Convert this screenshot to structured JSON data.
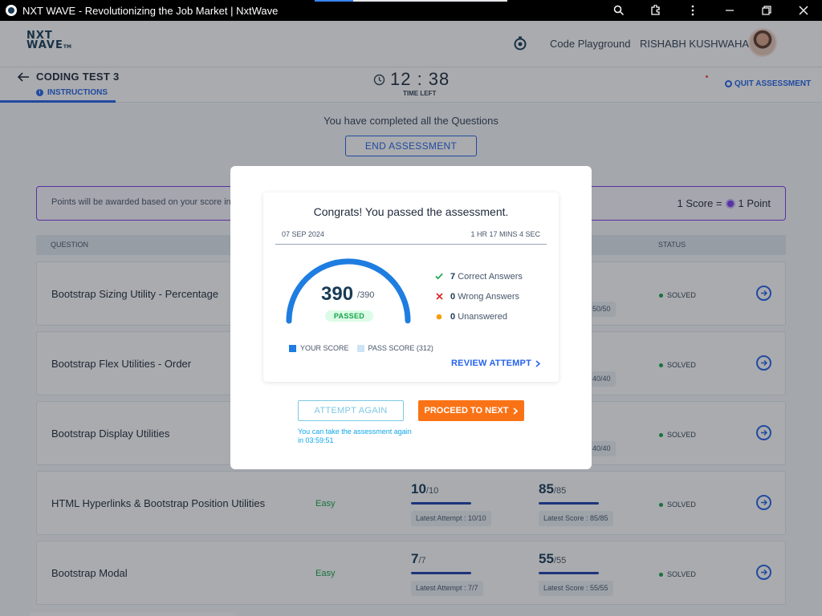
{
  "browser": {
    "title": "NXT WAVE - Revolutionizing the Job Market | NxtWave",
    "progress_fraction": 0.2
  },
  "header": {
    "logo_line1": "NXT",
    "logo_line2": "WAVE",
    "logo_tm": "TM",
    "playground": "Code Playground",
    "username": "RISHABH KUSHWAHA"
  },
  "subheader": {
    "test_title": "CODING TEST 3",
    "instructions": "INSTRUCTIONS",
    "timer": "12 : 38",
    "time_left_label": "TIME LEFT",
    "quit": "QUIT ASSESSMENT"
  },
  "main": {
    "completed_text": "You have completed all the Questions",
    "end_button": "END ASSESSMENT",
    "points_note": "Points will be awarded based on your score in",
    "score_eq": "1 Score =",
    "point_label": "1 Point",
    "columns": {
      "question": "QUESTION",
      "status": "STATUS"
    },
    "rows": [
      {
        "name": "Bootstrap Sizing Utility - Percentage",
        "difficulty": "",
        "attempt_big": "",
        "attempt_max": "",
        "attempt_chip": "",
        "score_big": "",
        "score_max": "",
        "score_chip": "50/50",
        "status": "SOLVED"
      },
      {
        "name": "Bootstrap Flex Utilities - Order",
        "difficulty": "",
        "attempt_big": "",
        "attempt_max": "",
        "attempt_chip": "",
        "score_big": "",
        "score_max": "",
        "score_chip": "40/40",
        "status": "SOLVED"
      },
      {
        "name": "Bootstrap Display Utilities",
        "difficulty": "",
        "attempt_big": "",
        "attempt_max": "",
        "attempt_chip": "",
        "score_big": "",
        "score_max": "",
        "score_chip": "40/40",
        "status": "SOLVED"
      },
      {
        "name": "HTML Hyperlinks & Bootstrap Position Utilities",
        "difficulty": "Easy",
        "attempt_big": "10",
        "attempt_max": "/10",
        "attempt_chip": "Latest Attempt : 10/10",
        "score_big": "85",
        "score_max": "/85",
        "score_chip": "Latest Score : 85/85",
        "status": "SOLVED"
      },
      {
        "name": "Bootstrap Modal",
        "difficulty": "Easy",
        "attempt_big": "7",
        "attempt_max": "/7",
        "attempt_chip": "Latest Attempt : 7/7",
        "score_big": "55",
        "score_max": "/55",
        "score_chip": "Latest Score : 55/55",
        "status": "SOLVED"
      }
    ]
  },
  "modal": {
    "congrats": "Congrats! You passed the assessment.",
    "date": "07 SEP 2024",
    "duration": "1 HR 17 MINS 4 SEC",
    "score": "390",
    "score_max": "/390",
    "passed_label": "PASSED",
    "score_fraction": 1.0,
    "pass_fraction": 0.8,
    "stats": [
      {
        "value": "7",
        "label": "Correct Answers",
        "icon": "check-icon"
      },
      {
        "value": "0",
        "label": "Wrong Answers",
        "icon": "cross-icon"
      },
      {
        "value": "0",
        "label": "Unanswered",
        "icon": "dot-icon"
      }
    ],
    "legend_your_score": "YOUR SCORE",
    "legend_pass_score": "PASS SCORE (312)",
    "review": "REVIEW ATTEMPT",
    "attempt_again": "ATTEMPT AGAIN",
    "retake_note": "You can take the assessment again in 03:59:51",
    "proceed": "PROCEED TO NEXT"
  },
  "colors": {
    "primary": "#2563eb",
    "gauge": "#1e7de0",
    "gauge_track": "#cfe3f7",
    "success": "#16a34a",
    "danger": "#dc2626",
    "warning": "#f59e0b",
    "accent": "#f97316",
    "brand_purple": "#7c3aed"
  }
}
